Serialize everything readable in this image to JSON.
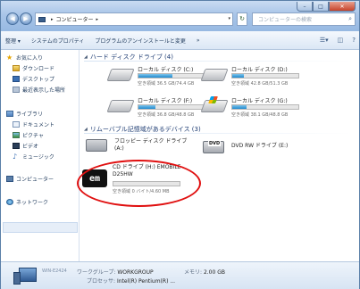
{
  "address": {
    "segments": [
      "コンピューター"
    ],
    "search_placeholder": "コンピューターの検索"
  },
  "window_controls": {
    "minimize": "–",
    "maximize": "□",
    "close": "✕"
  },
  "toolbar": {
    "organize": "整理 ▾",
    "system_properties": "システムのプロパティ",
    "uninstall": "プログラムのアンインストールと変更",
    "more": "»"
  },
  "nav": {
    "favorites": "お気に入り",
    "downloads": "ダウンロード",
    "desktop": "デスクトップ",
    "recent": "最近表示した場所",
    "libraries": "ライブラリ",
    "documents": "ドキュメント",
    "pictures": "ピクチャ",
    "videos": "ビデオ",
    "music": "ミュージック",
    "computer": "コンピューター",
    "network": "ネットワーク"
  },
  "groups": {
    "hdd": "ハード ディスク ドライブ (4)",
    "removable": "リムーバブル記憶域があるデバイス (3)"
  },
  "drives": [
    {
      "name": "ローカル ディスク (C:)",
      "free": "空き領域 36.5 GB/74.4 GB",
      "used_fraction": 0.51
    },
    {
      "name": "ローカル ディスク (D:)",
      "free": "空き領域 42.8 GB/51.3 GB",
      "used_fraction": 0.17
    },
    {
      "name": "ローカル ディスク (F:)",
      "free": "空き領域 36.8 GB/48.8 GB",
      "used_fraction": 0.25
    },
    {
      "name": "ローカル ディスク (G:)",
      "free": "空き領域 38.1 GB/48.8 GB",
      "used_fraction": 0.22
    }
  ],
  "removable": {
    "floppy_line1": "フロッピー ディスク ドライブ",
    "floppy_line2": "(A:)",
    "dvd": "DVD RW ドライブ (E:)",
    "cd_line1": "CD ドライブ (H:) EMOBILE",
    "cd_line2": "D25HW",
    "cd_free": "空き領域 0 バイト/4.60 MB",
    "cd_logo": "em"
  },
  "details": {
    "computer_name": "WIN-E2424",
    "workgroup_label": "ワークグループ:",
    "workgroup": "WORKGROUP",
    "memory_label": "メモリ:",
    "memory": "2.00 GB",
    "processor_label": "プロセッサ:",
    "processor": "Intel(R) Pentium(R) ..."
  }
}
